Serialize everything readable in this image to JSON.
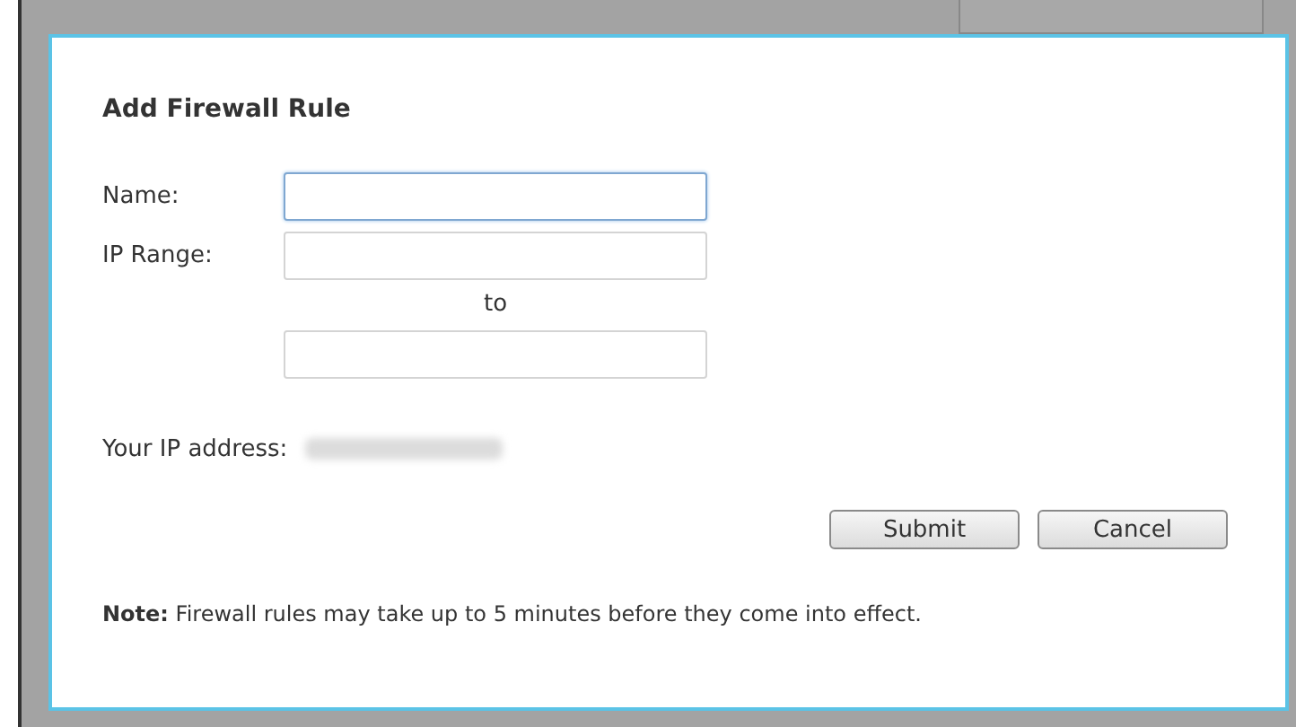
{
  "dialog": {
    "title": "Add Firewall Rule",
    "fields": [
      {
        "label": "Name:",
        "focused": true
      },
      {
        "label": "IP Range:",
        "focused": false
      },
      {
        "focused": false
      }
    ],
    "range_separator": "to",
    "ip_label": "Your IP address:",
    "buttons": [
      "Submit",
      "Cancel"
    ],
    "note_label": "Note:",
    "note_text": "Firewall rules may take up to 5 minutes before they come into effect."
  }
}
